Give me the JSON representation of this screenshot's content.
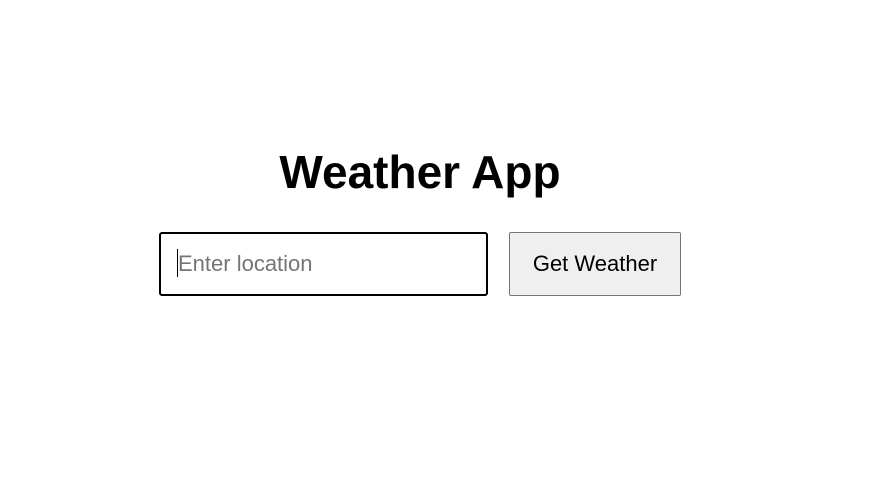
{
  "app": {
    "title": "Weather App"
  },
  "search": {
    "placeholder": "Enter location",
    "value": ""
  },
  "actions": {
    "get_weather_label": "Get Weather"
  },
  "colors": {
    "background": "#ffffff",
    "text": "#000000",
    "placeholder": "#757575",
    "button_background": "#efefef",
    "button_border": "#767676"
  }
}
